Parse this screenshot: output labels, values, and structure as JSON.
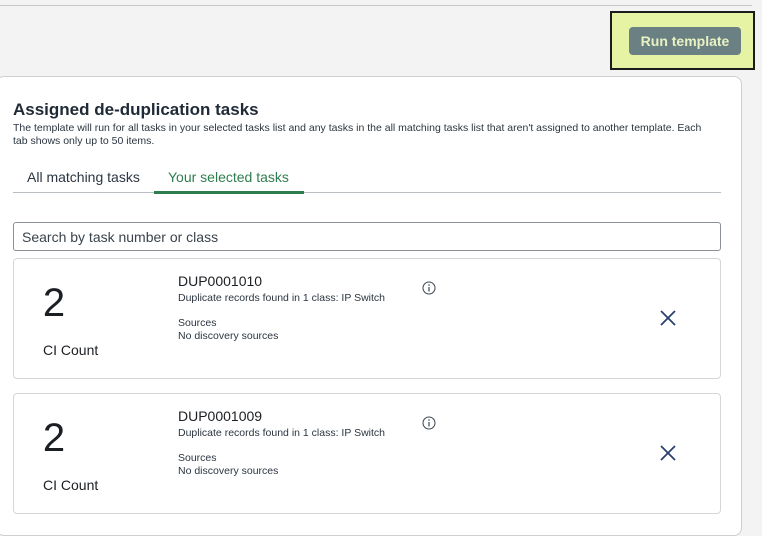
{
  "header": {
    "run_template_label": "Run template"
  },
  "section": {
    "title": "Assigned de-duplication tasks",
    "description": "The template will run for all tasks in your selected tasks list and any tasks in the all matching tasks list that aren't assigned to another template. Each tab shows only up to 50 items."
  },
  "tabs": [
    {
      "label": "All matching tasks",
      "active": false
    },
    {
      "label": "Your selected tasks",
      "active": true
    }
  ],
  "search": {
    "placeholder": "Search by task number or class",
    "value": ""
  },
  "tasks": [
    {
      "count": "2",
      "count_label": "CI Count",
      "number": "DUP0001010",
      "description": "Duplicate records found in 1 class: IP Switch",
      "sources_label": "Sources",
      "sources_value": "No discovery sources"
    },
    {
      "count": "2",
      "count_label": "CI Count",
      "number": "DUP0001009",
      "description": "Duplicate records found in 1 class: IP Switch",
      "sources_label": "Sources",
      "sources_value": "No discovery sources"
    }
  ],
  "icons": {
    "info": "info-icon",
    "remove": "close-icon"
  },
  "colors": {
    "accent_green": "#2e7d4f",
    "button_bg": "#6b8082",
    "highlight": "#e6f3a4"
  }
}
